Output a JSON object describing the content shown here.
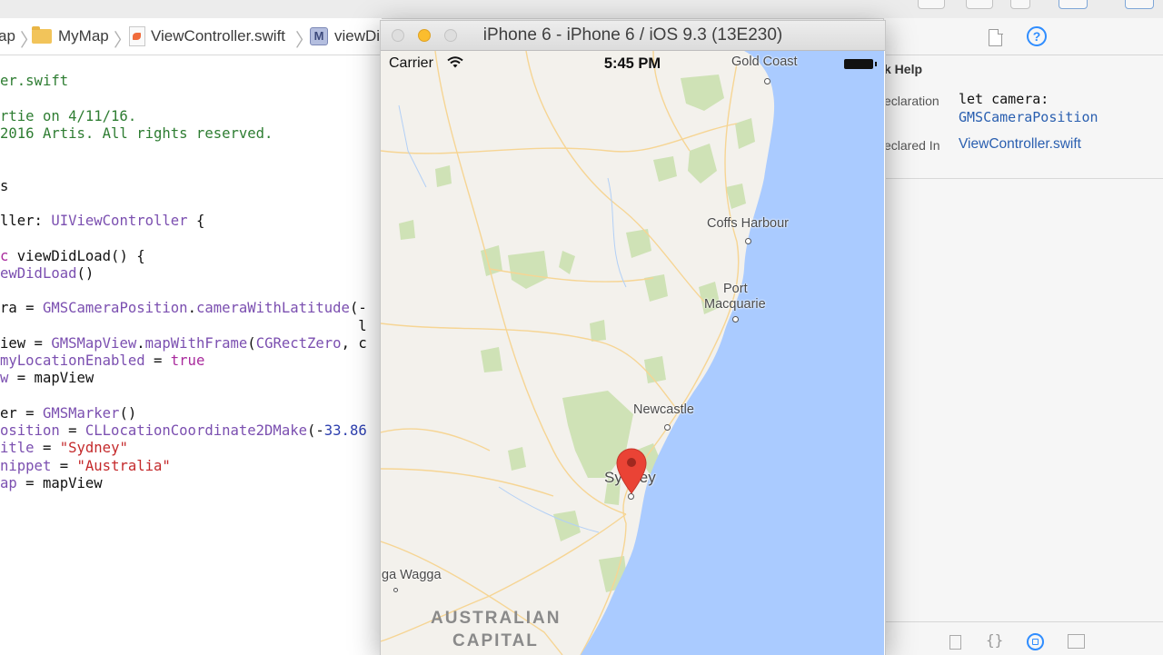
{
  "jump_bar": {
    "crumbs": [
      "ap",
      "MyMap",
      "ViewController.swift",
      "viewDi"
    ]
  },
  "code": {
    "lines": [
      [
        {
          "t": "er.swift",
          "c": "cmt"
        }
      ],
      [],
      [
        {
          "t": "rtie on 4/11/16.",
          "c": "cmt"
        }
      ],
      [
        {
          "t": "2016 Artis. All rights reserved.",
          "c": "cmt"
        }
      ],
      [],
      [],
      [
        {
          "t": "s",
          "c": "txt"
        }
      ],
      [],
      [
        {
          "t": "ller: ",
          "c": "txt"
        },
        {
          "t": "UIViewController",
          "c": "typ"
        },
        {
          "t": " {",
          "c": "txt"
        }
      ],
      [],
      [
        {
          "t": "c",
          "c": "kw"
        },
        {
          "t": " viewDidLoad() {",
          "c": "txt"
        }
      ],
      [
        {
          "t": "ewDidLoad",
          "c": "typ"
        },
        {
          "t": "()",
          "c": "txt"
        }
      ],
      [],
      [
        {
          "t": "ra",
          "c": "txt"
        },
        {
          "t": " = ",
          "c": "txt"
        },
        {
          "t": "GMSCameraPosition",
          "c": "typ"
        },
        {
          "t": ".",
          "c": "txt"
        },
        {
          "t": "cameraWithLatitude",
          "c": "typ"
        },
        {
          "t": "(-",
          "c": "txt"
        }
      ],
      [
        {
          "t": "                                          l",
          "c": "txt"
        }
      ],
      [
        {
          "t": "iew = ",
          "c": "txt"
        },
        {
          "t": "GMSMapView",
          "c": "typ"
        },
        {
          "t": ".",
          "c": "txt"
        },
        {
          "t": "mapWithFrame",
          "c": "typ"
        },
        {
          "t": "(",
          "c": "txt"
        },
        {
          "t": "CGRectZero",
          "c": "typ"
        },
        {
          "t": ", c",
          "c": "txt"
        }
      ],
      [
        {
          "t": "myLocationEnabled",
          "c": "typ"
        },
        {
          "t": " = ",
          "c": "txt"
        },
        {
          "t": "true",
          "c": "kw"
        }
      ],
      [
        {
          "t": "w",
          "c": "typ"
        },
        {
          "t": " = mapView",
          "c": "txt"
        }
      ],
      [],
      [
        {
          "t": "er = ",
          "c": "txt"
        },
        {
          "t": "GMSMarker",
          "c": "typ"
        },
        {
          "t": "()",
          "c": "txt"
        }
      ],
      [
        {
          "t": "osition",
          "c": "typ"
        },
        {
          "t": " = ",
          "c": "txt"
        },
        {
          "t": "CLLocationCoordinate2DMake",
          "c": "typ"
        },
        {
          "t": "(-",
          "c": "txt"
        },
        {
          "t": "33.86",
          "c": "num"
        }
      ],
      [
        {
          "t": "itle",
          "c": "typ"
        },
        {
          "t": " = ",
          "c": "txt"
        },
        {
          "t": "\"Sydney\"",
          "c": "str"
        }
      ],
      [
        {
          "t": "nippet",
          "c": "typ"
        },
        {
          "t": " = ",
          "c": "txt"
        },
        {
          "t": "\"Australia\"",
          "c": "str"
        }
      ],
      [
        {
          "t": "ap",
          "c": "typ"
        },
        {
          "t": " = mapView",
          "c": "txt"
        }
      ]
    ]
  },
  "simulator": {
    "title": "iPhone 6 - iPhone 6 / iOS 9.3 (13E230)",
    "status_bar": {
      "carrier": "Carrier",
      "time": "5:45 PM"
    },
    "map": {
      "places": [
        "Gold Coast",
        "Coffs Harbour",
        "Port",
        "Macquarie",
        "Newcastle",
        "Sydney",
        "ga Wagga"
      ],
      "region_lines": [
        "AUSTRALIAN",
        "CAPITAL"
      ]
    }
  },
  "quick_help": {
    "title": "k Help",
    "declaration_label": "eclaration",
    "declaration_code": "let camera:",
    "declaration_type": "GMSCameraPosition",
    "declared_in_label": "eclared In",
    "declared_in_value": "ViewController.swift"
  },
  "colors": {
    "comment": "#2e7d32",
    "type": "#7b4fb0",
    "keyword": "#a92b9d",
    "string": "#c4292b",
    "number": "#2d3fae",
    "water": "#aacbff",
    "land": "#f3f1ec",
    "park": "#cfe2b6",
    "road": "#f6d594",
    "marker": "#ea4335",
    "link": "#2a5fb0"
  },
  "icons": [
    "wifi-icon",
    "battery-icon",
    "map-marker-icon",
    "file-inspector-icon",
    "quick-help-icon",
    "folder-icon",
    "swift-file-icon",
    "method-icon"
  ]
}
